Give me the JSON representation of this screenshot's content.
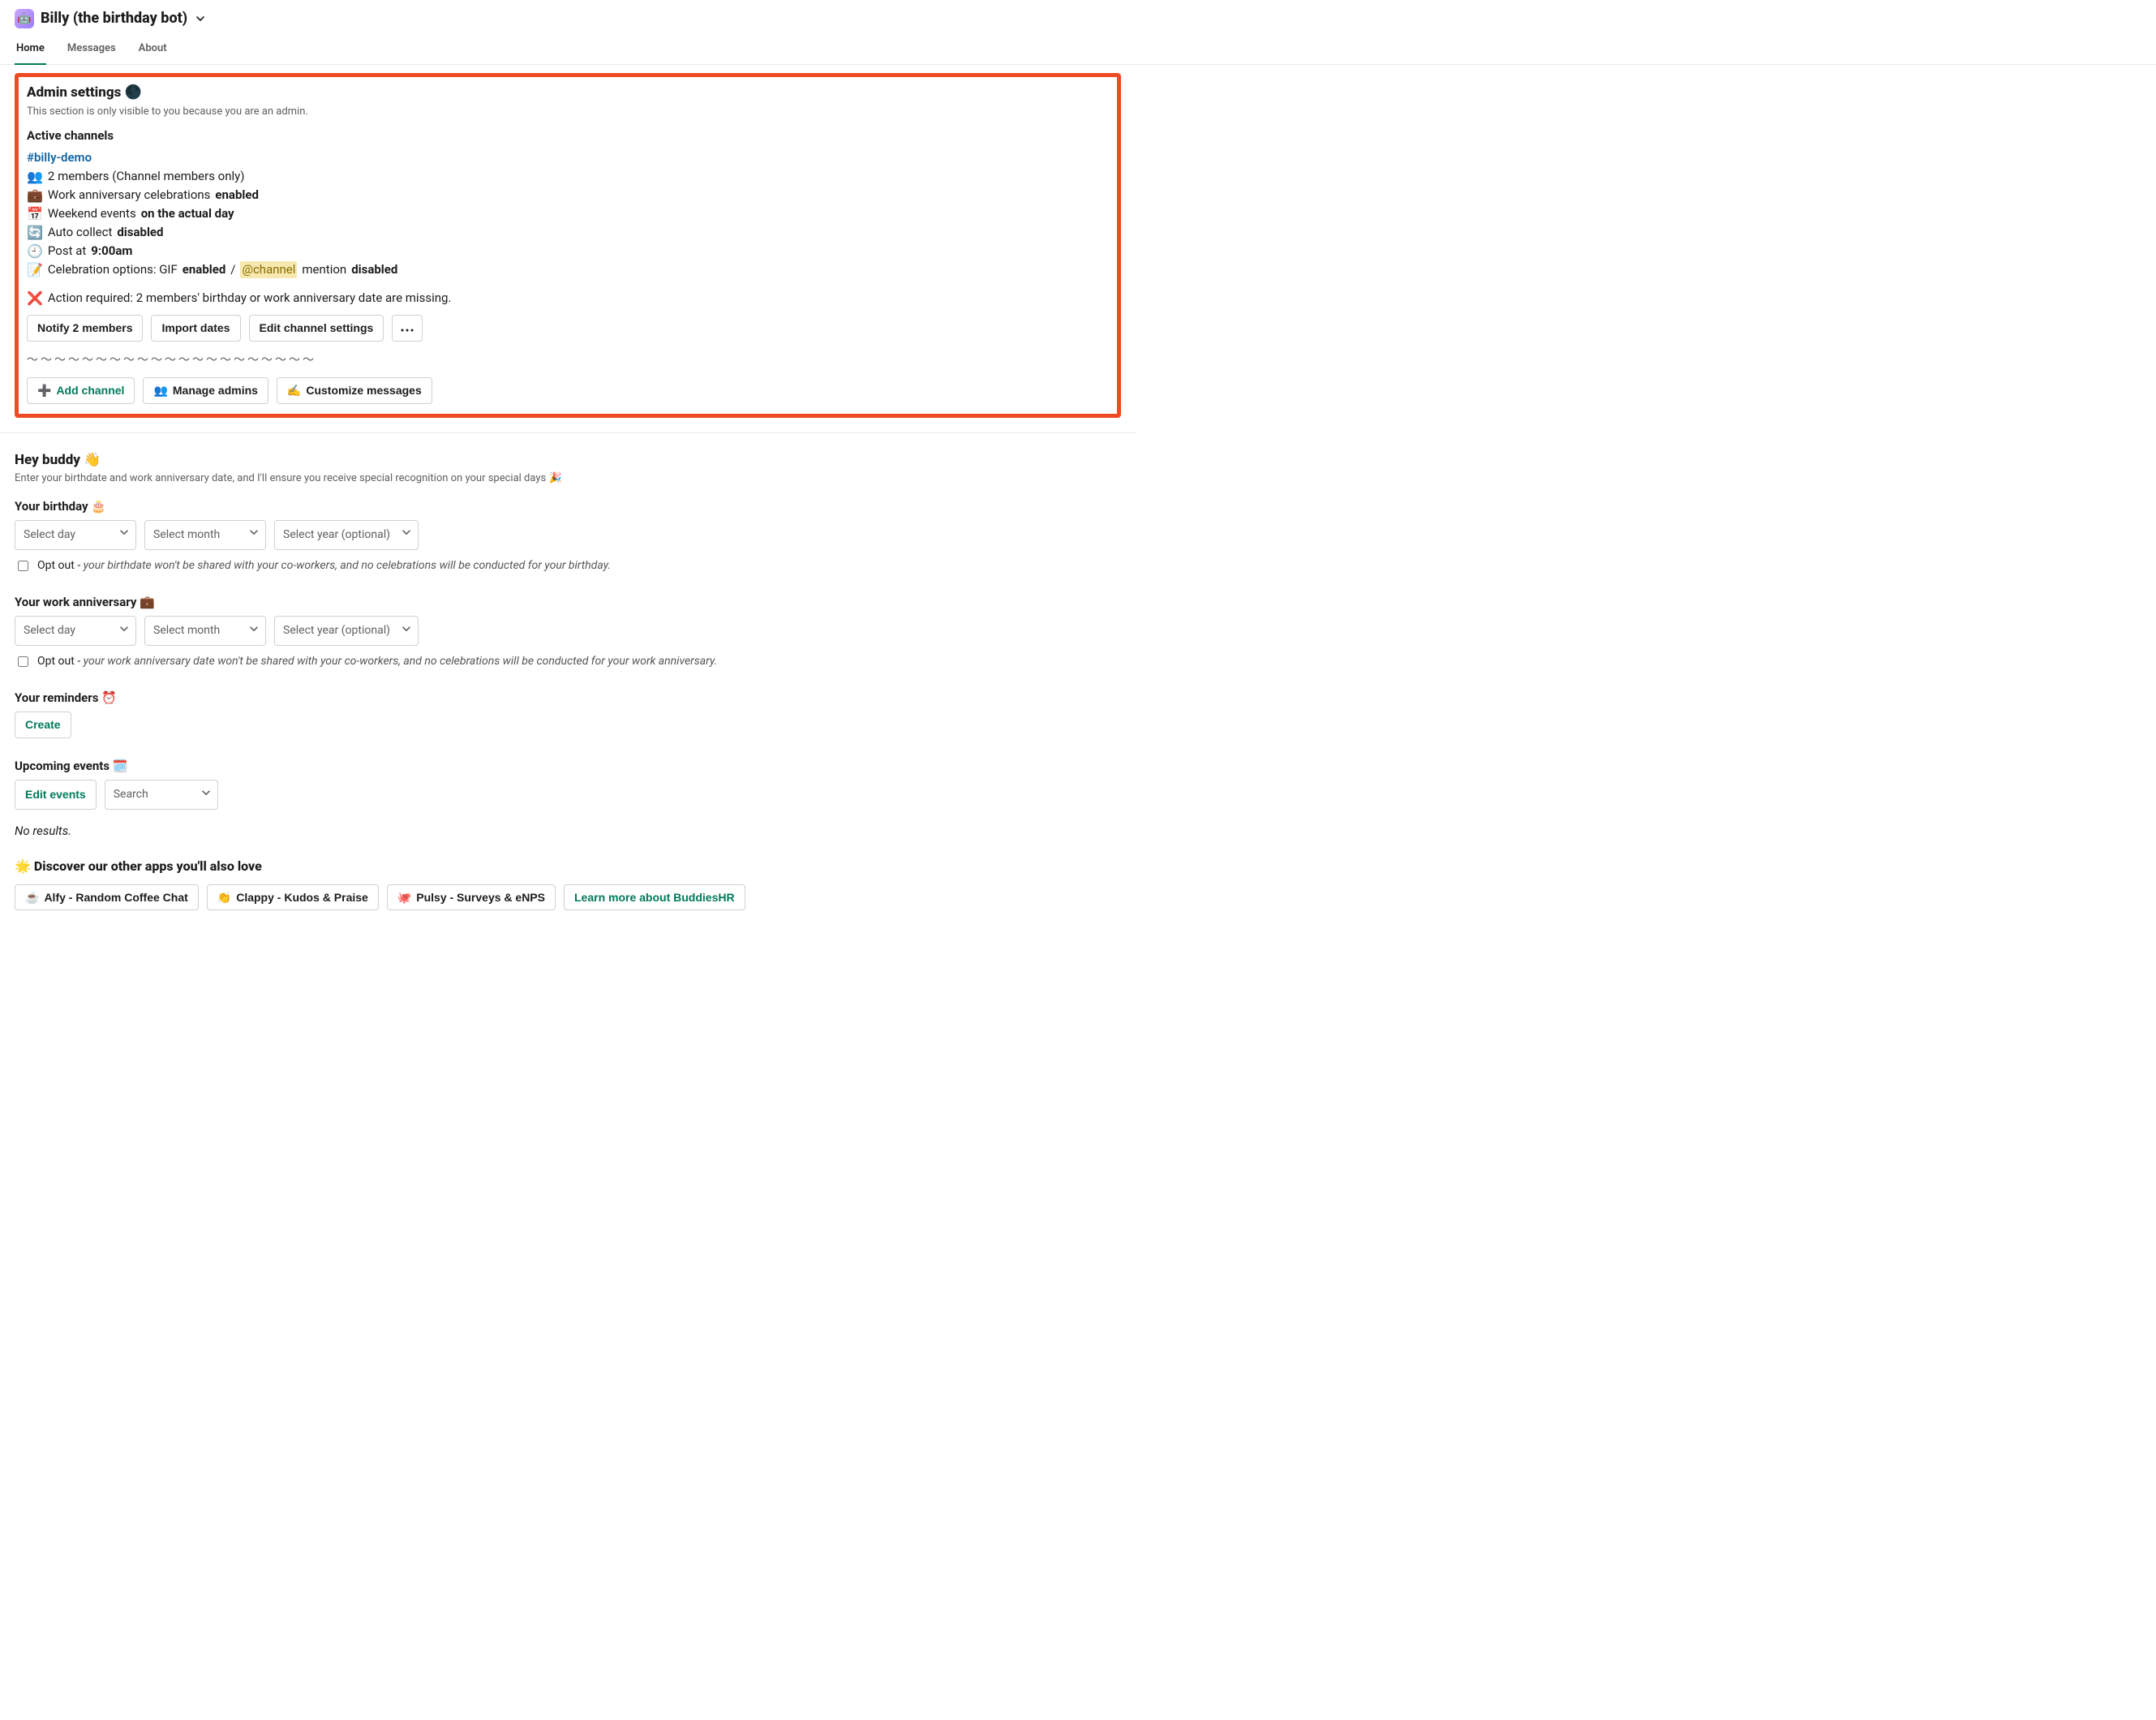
{
  "header": {
    "avatar_emoji": "🤖",
    "title": "Billy (the birthday bot)"
  },
  "tabs": {
    "home": "Home",
    "messages": "Messages",
    "about": "About"
  },
  "admin": {
    "title": "Admin settings 🌑",
    "subtitle": "This section is only visible to you because you are an admin.",
    "active_channels_title": "Active channels",
    "channel_link": "#billy-demo",
    "members_pre": " 2 members (Channel members only)",
    "anniv_pre": " Work anniversary celebrations ",
    "anniv_bold": "enabled",
    "weekend_pre": " Weekend events ",
    "weekend_bold": "on the actual day",
    "autocollect_pre": " Auto collect ",
    "autocollect_bold": "disabled",
    "post_pre": " Post at ",
    "post_bold": "9:00am",
    "celebrate_pre": " Celebration options: GIF ",
    "celebrate_gif_bold": "enabled",
    "celebrate_sep": " / ",
    "celebrate_mention": "@channel",
    "celebrate_mention_post": " mention ",
    "celebrate_mention_bold": "disabled",
    "action_required": " Action required: 2 members' birthday or work anniversary date are missing.",
    "btn_notify": "Notify 2 members",
    "btn_import": "Import dates",
    "btn_edit_channel": "Edit channel settings",
    "divider": "～～～～～～～～～～～～～～～～～～～～～",
    "btn_add_channel": "Add channel",
    "btn_manage_admins": "Manage admins",
    "btn_customize": "Customize messages"
  },
  "buddy": {
    "title": "Hey buddy 👋",
    "subtitle": "Enter your birthdate and work anniversary date, and I'll ensure you receive special recognition on your special days 🎉",
    "birthday_label": "Your birthday 🎂",
    "anniv_label": "Your work anniversary 💼",
    "reminders_label": "Your reminders ⏰",
    "upcoming_label": "Upcoming events 🗓️",
    "select_day": "Select day",
    "select_month": "Select month",
    "select_year": "Select year (optional)",
    "optout_label_pre": " Opt out ",
    "optout_sep": "- ",
    "optout_birthday_ital": "your birthdate won't be shared with your co-workers, and no celebrations will be conducted for your birthday.",
    "optout_anniv_ital": "your work anniversary date won't be shared with your co-workers, and no celebrations will be conducted for your work anniversary.",
    "btn_create": "Create",
    "btn_edit_events": "Edit events",
    "search_placeholder": "Search",
    "no_results": "No results."
  },
  "discover": {
    "title": "🌟 Discover our other apps you'll also love",
    "alfy": "Alfy - Random Coffee Chat",
    "clappy": "Clappy - Kudos & Praise",
    "pulsy": "Pulsy - Surveys & eNPS",
    "learn": "Learn more about BuddiesHR"
  },
  "emoji": {
    "members": "👥",
    "briefcase": "💼",
    "calendar": "📅",
    "recycle": "🔄",
    "clock": "🕘",
    "memo": "📝",
    "cross": "❌",
    "plus": "➕",
    "write": "✍️",
    "coffee": "☕",
    "clap": "👏",
    "octo": "🐙"
  }
}
